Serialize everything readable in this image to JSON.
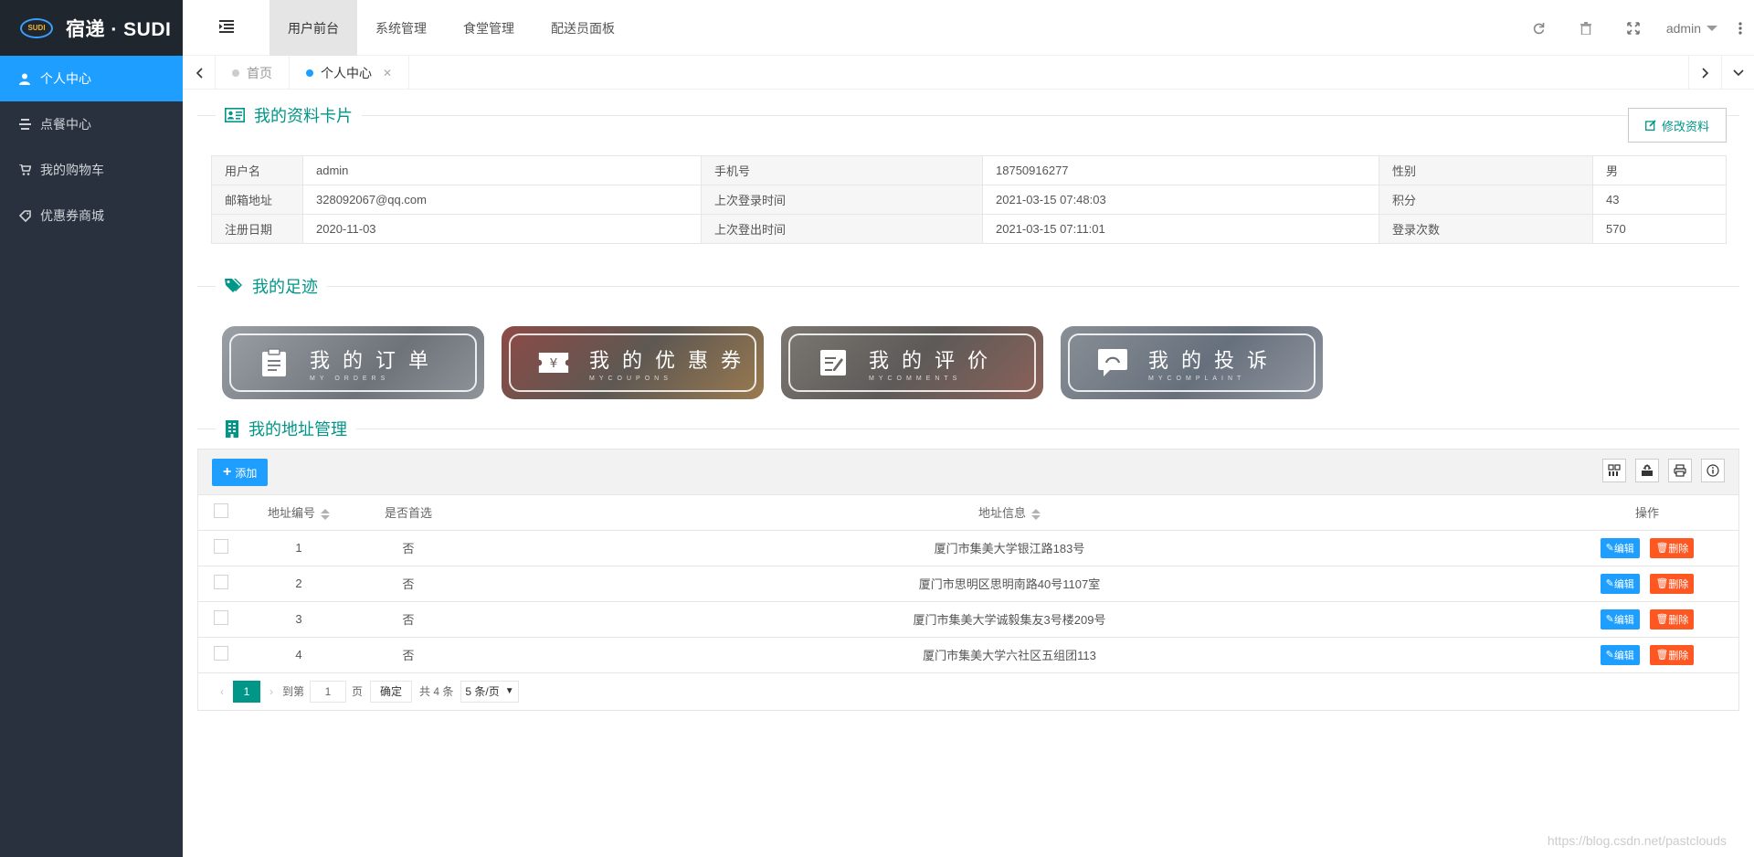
{
  "brand": {
    "badge": "SUDI",
    "name": "宿递 · SUDI"
  },
  "sidebar": {
    "items": [
      {
        "label": "个人中心",
        "icon": "user-icon"
      },
      {
        "label": "点餐中心",
        "icon": "list-icon"
      },
      {
        "label": "我的购物车",
        "icon": "cart-icon"
      },
      {
        "label": "优惠券商城",
        "icon": "tag-icon"
      }
    ]
  },
  "topnav": {
    "items": [
      "用户前台",
      "系统管理",
      "食堂管理",
      "配送员面板"
    ]
  },
  "header": {
    "user": "admin"
  },
  "tabs": {
    "items": [
      "首页",
      "个人中心"
    ]
  },
  "profile_section": {
    "title": "我的资料卡片",
    "edit_label": "修改资料"
  },
  "profile": {
    "rows": [
      [
        {
          "k": "用户名",
          "v": "admin"
        },
        {
          "k": "手机号",
          "v": "18750916277"
        },
        {
          "k": "性别",
          "v": "男"
        }
      ],
      [
        {
          "k": "邮箱地址",
          "v": "328092067@qq.com"
        },
        {
          "k": "上次登录时间",
          "v": "2021-03-15 07:48:03"
        },
        {
          "k": "积分",
          "v": "43"
        }
      ],
      [
        {
          "k": "注册日期",
          "v": "2020-11-03"
        },
        {
          "k": "上次登出时间",
          "v": "2021-03-15 07:11:01"
        },
        {
          "k": "登录次数",
          "v": "570"
        }
      ]
    ]
  },
  "footprint_section": {
    "title": "我的足迹"
  },
  "footprints": [
    {
      "title": "我的订单",
      "sub": "MY ORDERS",
      "icon": "clipboard-icon",
      "color": "#8a8f96"
    },
    {
      "title": "我的优惠券",
      "sub": "MYCOUPONS",
      "icon": "coupon-icon",
      "color": "#7a5b52"
    },
    {
      "title": "我的评价",
      "sub": "MYCOMMENTS",
      "icon": "comment-icon",
      "color": "#6f6a66"
    },
    {
      "title": "我的投诉",
      "sub": "MYCOMPLAINT",
      "icon": "complaint-icon",
      "color": "#7a7f86"
    }
  ],
  "address_section": {
    "title": "我的地址管理",
    "add_label": "添加"
  },
  "address_table": {
    "headers": {
      "id": "地址编号",
      "default": "是否首选",
      "info": "地址信息",
      "ops": "操作"
    },
    "rows": [
      {
        "id": "1",
        "default": "否",
        "info": "厦门市集美大学银江路183号"
      },
      {
        "id": "2",
        "default": "否",
        "info": "厦门市思明区思明南路40号1107室"
      },
      {
        "id": "3",
        "default": "否",
        "info": "厦门市集美大学诚毅集友3号楼209号"
      },
      {
        "id": "4",
        "default": "否",
        "info": "厦门市集美大学六社区五组团113"
      }
    ],
    "edit_label": "编辑",
    "delete_label": "删除"
  },
  "pager": {
    "current": "1",
    "goto_label": "到第",
    "page_input": "1",
    "page_unit": "页",
    "confirm": "确定",
    "total": "共 4 条",
    "per_page": "5 条/页"
  },
  "watermark": "https://blog.csdn.net/pastclouds",
  "colors": {
    "sidebar": "#28313d",
    "active": "#1e9fff",
    "accent": "#009688",
    "danger": "#ff5722"
  }
}
